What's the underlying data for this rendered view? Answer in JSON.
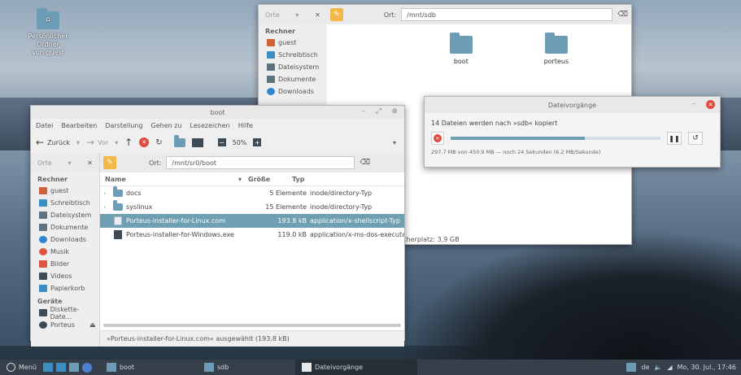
{
  "desktop": {
    "icon_label_1": "Persönlicher Ordner",
    "icon_label_2": "von guest"
  },
  "win_sdb": {
    "sidebar_header": "Orte",
    "sidebar_section": "Rechner",
    "sidebar_items": [
      "guest",
      "Schreibtisch",
      "Dateisystem",
      "Dokumente",
      "Downloads"
    ],
    "location_label": "Ort:",
    "location_value": "/mnt/sdb",
    "folders": [
      "boot",
      "porteus"
    ],
    "status_right": "Speicherplatz: 3,9 GB"
  },
  "win_boot": {
    "title": "boot",
    "menu": [
      "Datei",
      "Bearbeiten",
      "Darstellung",
      "Gehen zu",
      "Lesezeichen",
      "Hilfe"
    ],
    "back_label": "Zurück",
    "forward_label": "Vor",
    "zoom": "50%",
    "sidebar_header": "Orte",
    "sidebar_section1": "Rechner",
    "sidebar_items1": [
      "guest",
      "Schreibtisch",
      "Dateisystem",
      "Dokumente",
      "Downloads",
      "Musik",
      "Bilder",
      "Videos",
      "Papierkorb"
    ],
    "sidebar_section2": "Geräte",
    "sidebar_items2": [
      "Diskette-Date...",
      "Porteus"
    ],
    "location_label": "Ort:",
    "location_value": "/mnt/sr0/boot",
    "columns": {
      "name": "Name",
      "size": "Größe",
      "type": "Typ"
    },
    "rows": [
      {
        "name": "docs",
        "size": "5 Elemente",
        "type": "inode/directory-Typ"
      },
      {
        "name": "syslinux",
        "size": "15 Elemente",
        "type": "inode/directory-Typ"
      },
      {
        "name": "Porteus-installer-for-Linux.com",
        "size": "193.8 kB",
        "type": "application/x-shellscript-Typ"
      },
      {
        "name": "Porteus-installer-for-Windows.exe",
        "size": "119.0 kB",
        "type": "application/x-ms-dos-executable"
      }
    ],
    "status": "»Porteus-installer-for-Linux.com« ausgewählt (193.8 kB)"
  },
  "dialog": {
    "title": "Dateivorgänge",
    "message": "14 Dateien werden nach »sdb« kopiert",
    "progress_fraction": 0.64,
    "detail": "297.7 MB von 450.9 MB — noch 24 Sekunden (6.2 MB/Sekunde)"
  },
  "taskbar": {
    "menu_label": "Menü",
    "items": [
      "boot",
      "sdb",
      "Dateivorgänge"
    ],
    "lang": "de",
    "clock": "Mo, 30. Jul., 17:46"
  }
}
